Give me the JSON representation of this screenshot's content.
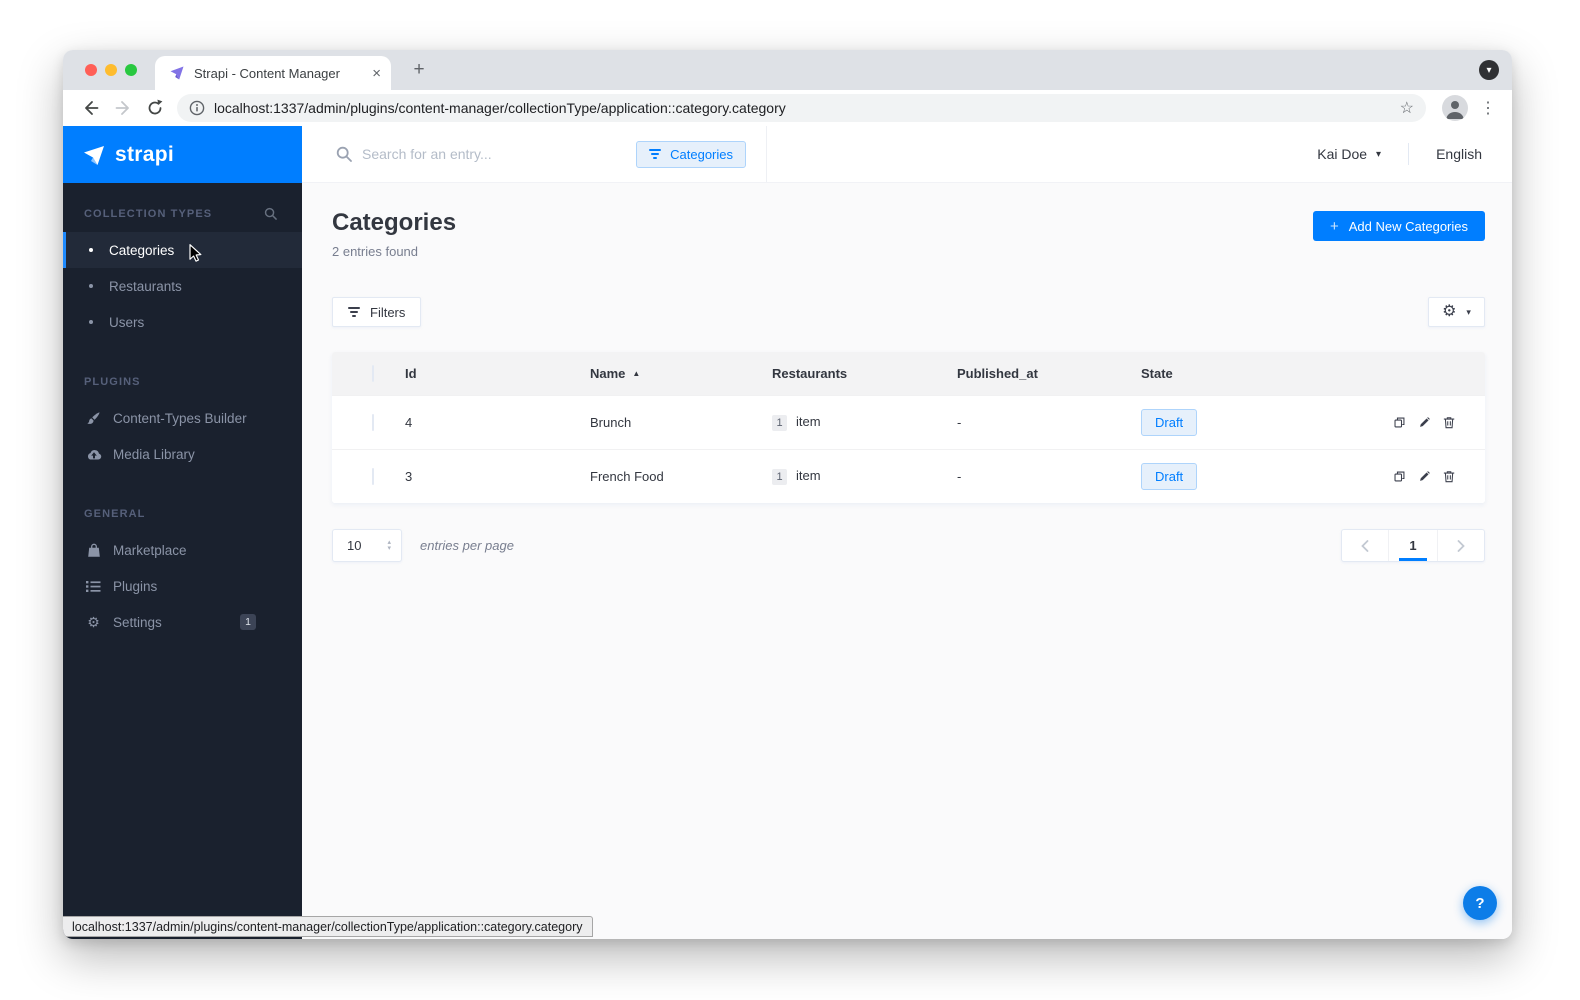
{
  "icons": {
    "close": "×",
    "plus": "+",
    "caret_down": "▾",
    "sort_asc": "▲",
    "star": "☆",
    "kebab": "⋮",
    "stepper_up": "▴",
    "stepper_down": "▾",
    "gear": "⚙"
  },
  "browser": {
    "tab_title": "Strapi - Content Manager",
    "url": "localhost:1337/admin/plugins/content-manager/collectionType/application::category.category",
    "status_url": "localhost:1337/admin/plugins/content-manager/collectionType/application::category.category"
  },
  "sidebar": {
    "logo_text": "strapi",
    "sections": [
      {
        "label": "COLLECTION TYPES",
        "items": [
          {
            "label": "Categories"
          },
          {
            "label": "Restaurants"
          },
          {
            "label": "Users"
          }
        ]
      },
      {
        "label": "PLUGINS",
        "items": [
          {
            "label": "Content-Types Builder"
          },
          {
            "label": "Media Library"
          }
        ]
      },
      {
        "label": "GENERAL",
        "items": [
          {
            "label": "Marketplace"
          },
          {
            "label": "Plugins"
          },
          {
            "label": "Settings",
            "badge": "1"
          }
        ]
      }
    ]
  },
  "header": {
    "search_placeholder": "Search for an entry...",
    "filter_chip": "Categories",
    "user_name": "Kai Doe",
    "language": "English"
  },
  "page": {
    "title": "Categories",
    "subtitle": "2 entries found",
    "add_button_label": "Add New Categories",
    "filters_button_label": "Filters"
  },
  "table": {
    "columns": [
      "Id",
      "Name",
      "Restaurants",
      "Published_at",
      "State"
    ],
    "sorted_by": "Name",
    "sort_direction": "asc",
    "rows": [
      {
        "id": "4",
        "name": "Brunch",
        "restaurants_count": "1",
        "restaurants_unit": "item",
        "published_at": "-",
        "state": "Draft"
      },
      {
        "id": "3",
        "name": "French Food",
        "restaurants_count": "1",
        "restaurants_unit": "item",
        "published_at": "-",
        "state": "Draft"
      }
    ]
  },
  "pagination": {
    "per_page": "10",
    "per_page_label": "entries per page",
    "current_page": "1"
  },
  "help": {
    "label": "?"
  },
  "colors": {
    "accent": "#007eff",
    "sidebar_bg": "#1a212e",
    "chip_bg": "#e6f0fb",
    "chip_border": "#aed4fb",
    "draft_text": "#007eff",
    "table_header_bg": "#f3f3f4"
  }
}
